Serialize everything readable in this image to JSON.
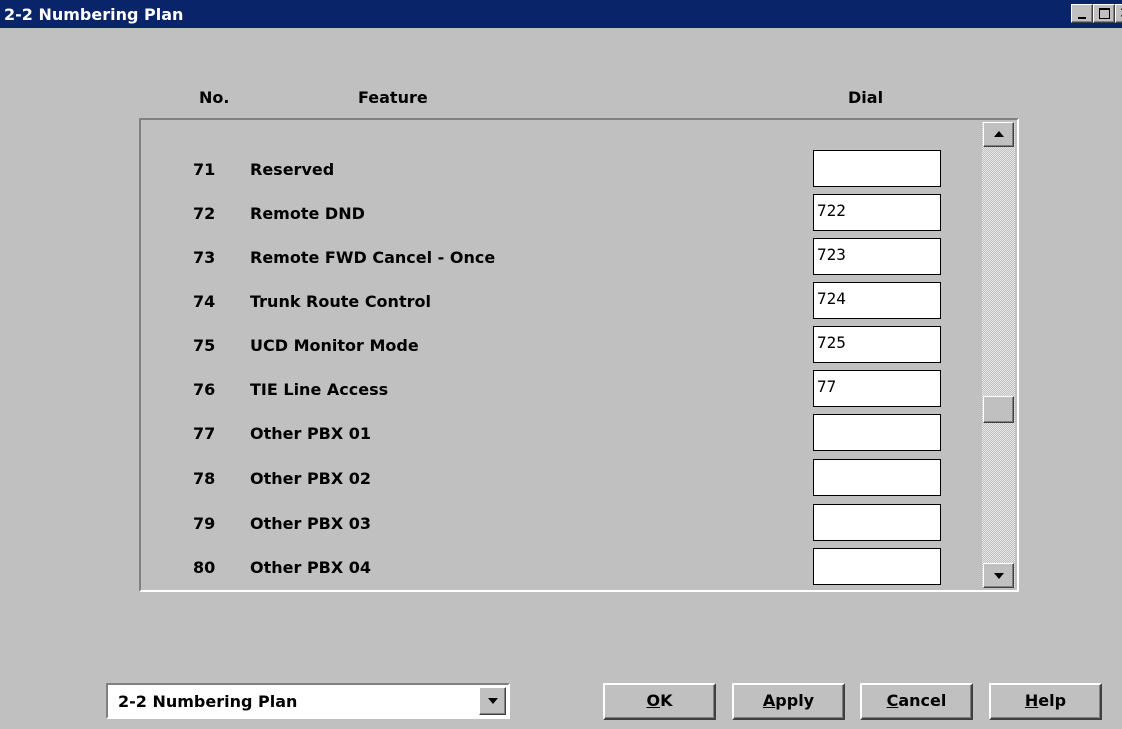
{
  "window": {
    "title": "2-2 Numbering Plan"
  },
  "headers": {
    "no": "No.",
    "feature": "Feature",
    "dial": "Dial"
  },
  "rows": [
    {
      "no": "71",
      "feature": "Reserved",
      "dial": ""
    },
    {
      "no": "72",
      "feature": "Remote DND",
      "dial": "722"
    },
    {
      "no": "73",
      "feature": "Remote FWD Cancel - Once",
      "dial": "723"
    },
    {
      "no": "74",
      "feature": "Trunk Route Control",
      "dial": "724"
    },
    {
      "no": "75",
      "feature": "UCD Monitor Mode",
      "dial": "725"
    },
    {
      "no": "76",
      "feature": "TIE Line Access",
      "dial": "77"
    },
    {
      "no": "77",
      "feature": "Other PBX 01",
      "dial": ""
    },
    {
      "no": "78",
      "feature": "Other PBX 02",
      "dial": ""
    },
    {
      "no": "79",
      "feature": "Other PBX 03",
      "dial": ""
    },
    {
      "no": "80",
      "feature": "Other PBX 04",
      "dial": ""
    }
  ],
  "footer": {
    "page_select_value": "2-2 Numbering Plan",
    "ok": {
      "mnemonic": "O",
      "rest": "K"
    },
    "apply": {
      "mnemonic": "A",
      "rest": "pply"
    },
    "cancel": {
      "mnemonic": "C",
      "rest": "ancel"
    },
    "help": {
      "mnemonic": "H",
      "rest": "elp"
    }
  },
  "colors": {
    "titlebar": "#0a246a",
    "window_bg": "#c0c0c0",
    "field_bg": "#ffffff"
  }
}
